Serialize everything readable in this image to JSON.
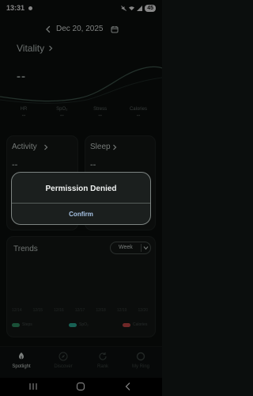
{
  "status_bar": {
    "time": "13:31",
    "battery": "45"
  },
  "date_nav": {
    "date": "Dec 20, 2025"
  },
  "vitality": {
    "title": "Vitality",
    "value": "--",
    "metrics": [
      {
        "label": "HR",
        "value": "--"
      },
      {
        "label": "SpO₂",
        "value": "--"
      },
      {
        "label": "Stress",
        "value": "--"
      },
      {
        "label": "Calories",
        "value": "--"
      }
    ]
  },
  "activity": {
    "title": "Activity",
    "value": "--"
  },
  "sleep": {
    "title": "Sleep",
    "value": "--"
  },
  "trends": {
    "title": "Trends",
    "period": "Week",
    "x_ticks": [
      "12/14",
      "12/15",
      "12/16",
      "12/17",
      "12/18",
      "12/19",
      "12/20"
    ],
    "legend": [
      {
        "label": "Steps",
        "color": "#2e8a5f"
      },
      {
        "label": "SpO₂",
        "color": "#2aa892"
      },
      {
        "label": "Calories",
        "color": "#c24646"
      }
    ]
  },
  "tabs": [
    {
      "label": "Spotlight",
      "icon": "spotlight-icon",
      "active": true
    },
    {
      "label": "Discover",
      "icon": "compass-icon",
      "active": false
    },
    {
      "label": "Rank",
      "icon": "refresh-icon",
      "active": false
    },
    {
      "label": "My Ring",
      "icon": "ring-icon",
      "active": false
    }
  ],
  "dialog": {
    "title": "Permission Denied",
    "confirm_label": "Confirm"
  },
  "colors": {
    "background": "#0b0e0d",
    "card": "#141816",
    "dialog": "#1b1f1e",
    "dialog_button": "#a8c4e6",
    "accent_wave": "#5f7d70"
  }
}
